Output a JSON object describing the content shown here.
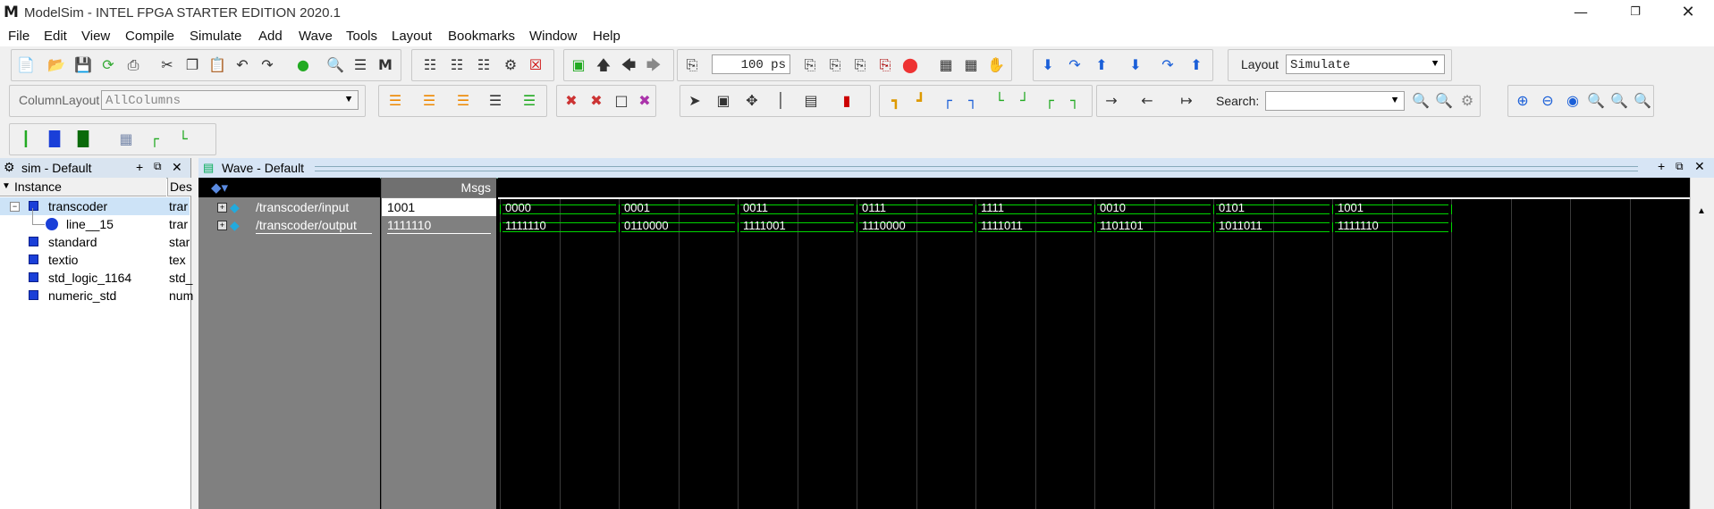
{
  "window": {
    "title": "ModelSim - INTEL FPGA STARTER EDITION 2020.1",
    "logo": "M"
  },
  "menu": [
    "File",
    "Edit",
    "View",
    "Compile",
    "Simulate",
    "Add",
    "Wave",
    "Tools",
    "Layout",
    "Bookmarks",
    "Window",
    "Help"
  ],
  "toolbar": {
    "time_value": "100 ps",
    "layout_label": "Layout",
    "layout_value": "Simulate",
    "column_layout_label": "ColumnLayout",
    "column_layout_value": "AllColumns",
    "search_label": "Search:",
    "search_value": ""
  },
  "sim_pane": {
    "title": "sim - Default",
    "columns": [
      "Instance",
      "Des"
    ],
    "rows": [
      {
        "name": "transcoder",
        "design": "trar",
        "level": 0,
        "expanded": true,
        "selected": true,
        "icon": "design-unit-icon"
      },
      {
        "name": "line__15",
        "design": "trar",
        "level": 1,
        "icon": "process-icon"
      },
      {
        "name": "standard",
        "design": "star",
        "level": 0,
        "icon": "package-icon"
      },
      {
        "name": "textio",
        "design": "tex",
        "level": 0,
        "icon": "package-icon"
      },
      {
        "name": "std_logic_1164",
        "design": "std_",
        "level": 0,
        "icon": "package-icon"
      },
      {
        "name": "numeric_std",
        "design": "num",
        "level": 0,
        "icon": "package-icon"
      }
    ]
  },
  "wave_pane": {
    "title": "Wave - Default",
    "msgs_header": "Msgs",
    "signals": [
      {
        "name": "/transcoder/input",
        "value": "1001"
      },
      {
        "name": "/transcoder/output",
        "value": "1111110"
      }
    ],
    "input_segments": [
      "0000",
      "0001",
      "0011",
      "0111",
      "1111",
      "0010",
      "0101",
      "1001"
    ],
    "output_segments": [
      "1111110",
      "0110000",
      "1111001",
      "1110000",
      "1111011",
      "1101101",
      "1011011",
      "1111110"
    ],
    "colors": {
      "trace": "#00d700",
      "background": "#000000",
      "names_bg": "#808080"
    }
  }
}
